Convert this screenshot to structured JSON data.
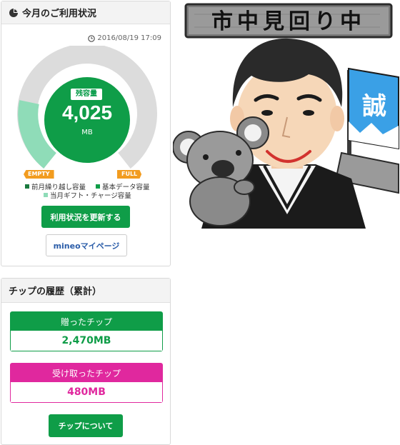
{
  "usage_panel": {
    "title": "今月のご利用状況",
    "timestamp": "2016/08/19 17:09",
    "remaining_label": "残容量",
    "remaining_value": "4,025",
    "remaining_unit": "MB",
    "empty_label": "EMPTY",
    "full_label": "FULL",
    "legend": {
      "carryover": "前月繰り越し容量",
      "basic": "基本データ容量",
      "gift": "当月ギフト・チャージ容量"
    },
    "refresh_button": "利用状況を更新する",
    "mypage_button": "mineoマイページ",
    "colors": {
      "carryover": "#1a7a3e",
      "basic": "#0f9d48",
      "gift": "#8fdcb8",
      "track": "#dcdcdc",
      "accent": "#f29c1f"
    }
  },
  "tips_panel": {
    "title": "チップの履歴（累計）",
    "sent_label": "贈ったチップ",
    "sent_value": "2,470MB",
    "received_label": "受け取ったチップ",
    "received_value": "480MB",
    "about_button": "チップについて",
    "colors": {
      "sent": "#0f9d48",
      "received": "#e0289e"
    }
  },
  "illustration": {
    "banner_text": "市中見回り中",
    "flag_text": "誠"
  }
}
